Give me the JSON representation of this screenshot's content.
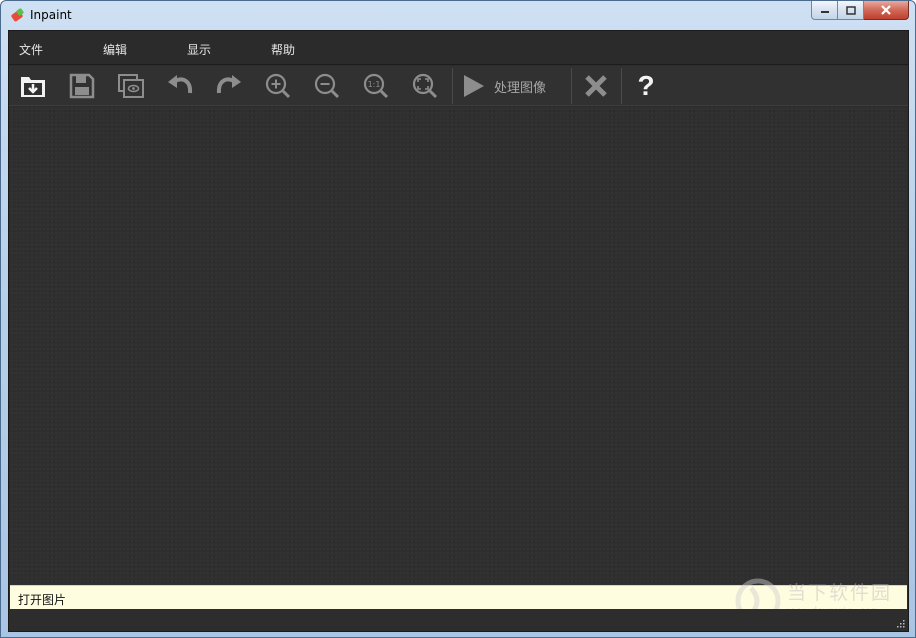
{
  "window": {
    "title": "Inpaint",
    "controls": {
      "minimize": "minimize",
      "maximize": "maximize",
      "close": "close"
    }
  },
  "menu": {
    "items": [
      {
        "label": "文件"
      },
      {
        "label": "编辑"
      },
      {
        "label": "显示"
      },
      {
        "label": "帮助"
      }
    ]
  },
  "toolbar": {
    "buttons": [
      {
        "icon": "open-folder-icon"
      },
      {
        "icon": "save-icon"
      },
      {
        "icon": "preview-icon"
      },
      {
        "icon": "undo-icon"
      },
      {
        "icon": "redo-icon"
      },
      {
        "icon": "zoom-in-icon"
      },
      {
        "icon": "zoom-out-icon"
      },
      {
        "icon": "zoom-actual-icon"
      },
      {
        "icon": "zoom-fit-icon"
      }
    ],
    "process_label": "处理图像",
    "zoom_actual_text": "1:1",
    "cancel_icon": "close-x-icon",
    "help_label": "?"
  },
  "status": {
    "text": "打开图片"
  },
  "watermark": {
    "text": "当下软件园",
    "url": "www.downxia.com"
  },
  "colors": {
    "client_bg": "#2d2d2d",
    "icon_white": "#f2f2f2",
    "icon_gray": "#8d8d8d",
    "status_bg": "#fffde0"
  }
}
